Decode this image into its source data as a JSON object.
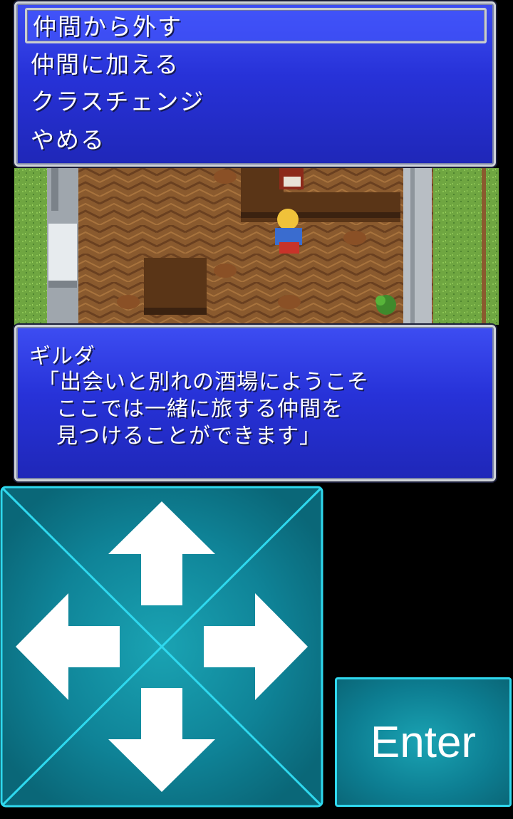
{
  "menu": {
    "items": [
      {
        "label": "仲間から外す",
        "selected": true
      },
      {
        "label": "仲間に加える",
        "selected": false
      },
      {
        "label": "クラスチェンジ",
        "selected": false
      },
      {
        "label": "やめる",
        "selected": false
      }
    ]
  },
  "dialog": {
    "speaker": "ギルダ",
    "lines": [
      "「出会いと別れの酒場にようこそ",
      "ここでは一緒に旅する仲間を",
      "見つけることができます」"
    ]
  },
  "controls": {
    "enter_label": "Enter",
    "dpad_directions": [
      "up",
      "down",
      "left",
      "right"
    ],
    "accent_color": "#2fd8ee",
    "pad_color": "#0f8397"
  },
  "colors": {
    "window_blue": "#2732d8",
    "window_border": "#cfd3d8",
    "floor": "#8a5a2e",
    "grass": "#6fa641"
  }
}
